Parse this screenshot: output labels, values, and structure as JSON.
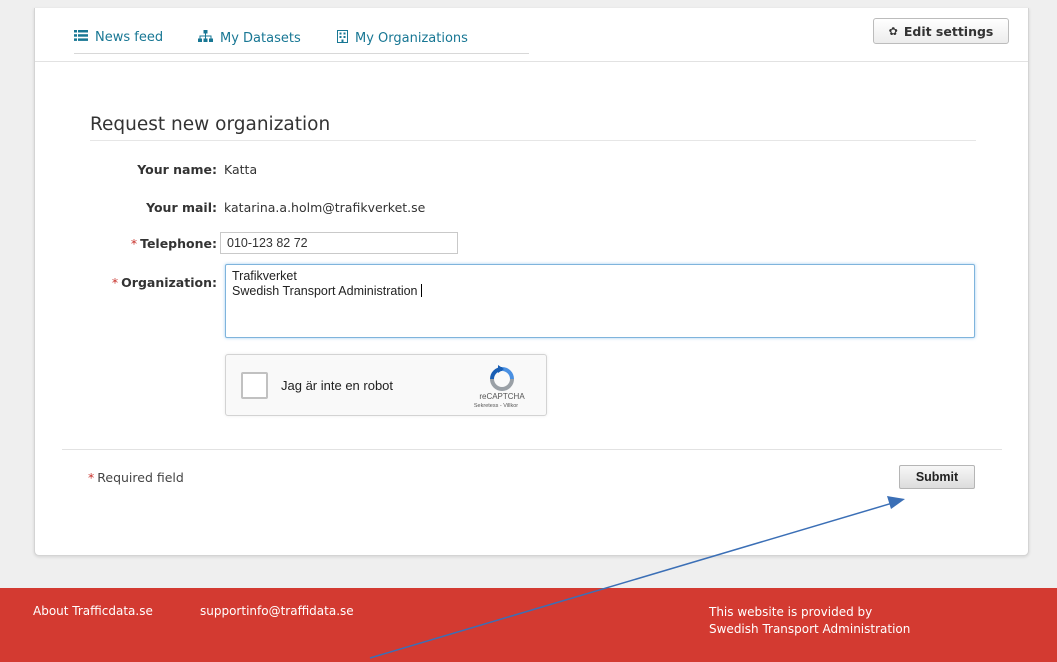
{
  "tabs": [
    {
      "label": "News feed",
      "icon": "list-icon"
    },
    {
      "label": "My Datasets",
      "icon": "sitemap-icon"
    },
    {
      "label": "My Organizations",
      "icon": "building-icon"
    }
  ],
  "edit_settings": {
    "label": "Edit settings",
    "icon": "gear-icon"
  },
  "form": {
    "title": "Request new organization",
    "name": {
      "label": "Your name:",
      "value": "Katta"
    },
    "mail": {
      "label": "Your mail:",
      "value": "katarina.a.holm@trafikverket.se"
    },
    "telephone": {
      "label": "Telephone:",
      "value": "010-123 82 72",
      "required": true
    },
    "organization": {
      "label": "Organization:",
      "required": true,
      "lines": [
        "Trafikverket",
        "Swedish Transport Administration"
      ]
    },
    "required_marker": "*"
  },
  "captcha": {
    "text": "Jag är inte en robot",
    "brand": "reCAPTCHA",
    "terms": "Sekretess - Villkor"
  },
  "footer_form": {
    "required_note": "Required field",
    "submit_label": "Submit"
  },
  "site_footer": {
    "about": "About Trafficdata.se",
    "support": "supportinfo@traffidata.se",
    "provided_line1": "This website is provided by",
    "provided_line2": "Swedish Transport Administration"
  },
  "colors": {
    "link": "#187794",
    "footer_bg": "#d33a31",
    "required": "#c8312b",
    "annotation_arrow": "#3b6fb6"
  }
}
